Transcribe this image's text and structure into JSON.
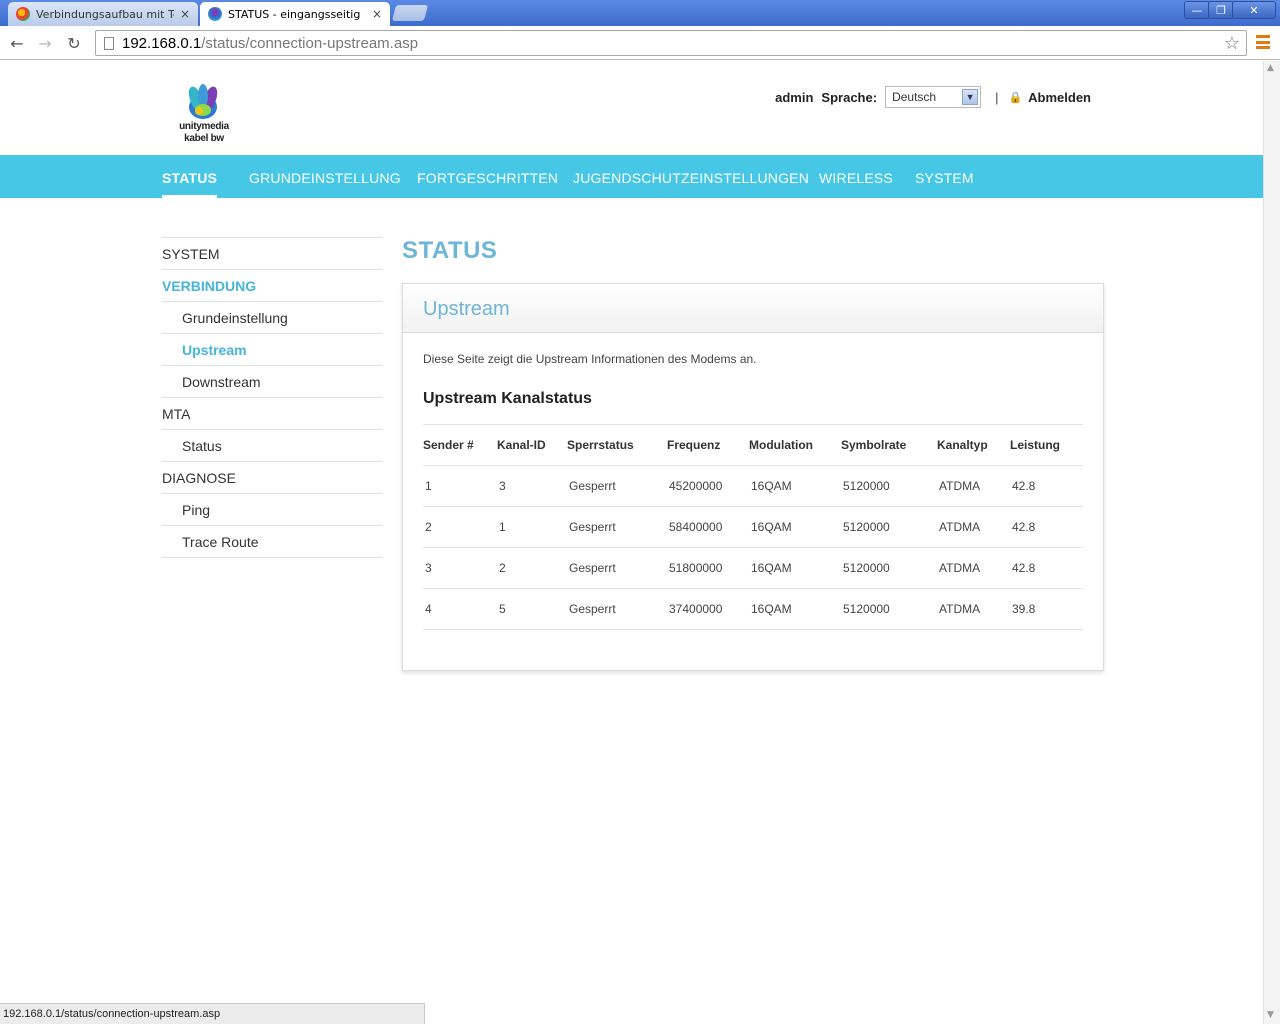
{
  "browser": {
    "tabs": [
      {
        "label": "Verbindungsaufbau mit Tech",
        "close": "×"
      },
      {
        "label": "STATUS - eingangsseitig",
        "close": "×"
      }
    ],
    "address": {
      "host": "192.168.0.1",
      "path": "/status/connection-upstream.asp"
    },
    "status_url": "192.168.0.1/status/connection-upstream.asp"
  },
  "header": {
    "logo_line1": "unitymedia",
    "logo_line2": "kabel bw",
    "user": "admin",
    "language_label": "Sprache:",
    "language_value": "Deutsch",
    "logout": "Abmelden"
  },
  "nav": [
    {
      "label": "STATUS"
    },
    {
      "label": "GRUNDEINSTELLUNG"
    },
    {
      "label": "FORTGESCHRITTEN"
    },
    {
      "label": "JUGENDSCHUTZEINSTELLUNGEN"
    },
    {
      "label": "WIRELESS"
    },
    {
      "label": "SYSTEM"
    }
  ],
  "sidebar": [
    {
      "label": "SYSTEM"
    },
    {
      "label": "VERBINDUNG"
    },
    {
      "label": "Grundeinstellung"
    },
    {
      "label": "Upstream"
    },
    {
      "label": "Downstream"
    },
    {
      "label": "MTA"
    },
    {
      "label": "Status"
    },
    {
      "label": "DIAGNOSE"
    },
    {
      "label": "Ping"
    },
    {
      "label": "Trace Route"
    }
  ],
  "page_title": "STATUS",
  "panel": {
    "title": "Upstream",
    "description": "Diese Seite zeigt die Upstream Informationen des Modems an.",
    "subtitle": "Upstream Kanalstatus",
    "columns": [
      "Sender #",
      "Kanal-ID",
      "Sperrstatus",
      "Frequenz",
      "Modulation",
      "Symbolrate",
      "Kanaltyp",
      "Leistung"
    ],
    "rows": [
      [
        "1",
        "3",
        "Gesperrt",
        "45200000",
        "16QAM",
        "5120000",
        "ATDMA",
        "42.8"
      ],
      [
        "2",
        "1",
        "Gesperrt",
        "58400000",
        "16QAM",
        "5120000",
        "ATDMA",
        "42.8"
      ],
      [
        "3",
        "2",
        "Gesperrt",
        "51800000",
        "16QAM",
        "5120000",
        "ATDMA",
        "42.8"
      ],
      [
        "4",
        "5",
        "Gesperrt",
        "37400000",
        "16QAM",
        "5120000",
        "ATDMA",
        "39.8"
      ]
    ]
  },
  "colors": {
    "accent": "#47c7e6",
    "heading": "#6fb6d6",
    "active_link": "#47b5d8"
  }
}
